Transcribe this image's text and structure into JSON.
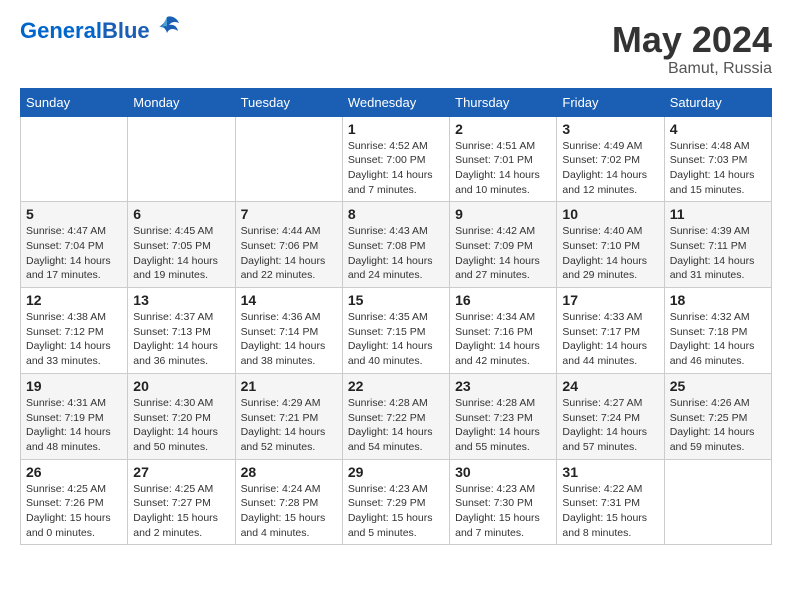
{
  "header": {
    "logo_general": "General",
    "logo_blue": "Blue",
    "month_title": "May 2024",
    "location": "Bamut, Russia"
  },
  "weekdays": [
    "Sunday",
    "Monday",
    "Tuesday",
    "Wednesday",
    "Thursday",
    "Friday",
    "Saturday"
  ],
  "weeks": [
    [
      {
        "day": "",
        "info": ""
      },
      {
        "day": "",
        "info": ""
      },
      {
        "day": "",
        "info": ""
      },
      {
        "day": "1",
        "info": "Sunrise: 4:52 AM\nSunset: 7:00 PM\nDaylight: 14 hours\nand 7 minutes."
      },
      {
        "day": "2",
        "info": "Sunrise: 4:51 AM\nSunset: 7:01 PM\nDaylight: 14 hours\nand 10 minutes."
      },
      {
        "day": "3",
        "info": "Sunrise: 4:49 AM\nSunset: 7:02 PM\nDaylight: 14 hours\nand 12 minutes."
      },
      {
        "day": "4",
        "info": "Sunrise: 4:48 AM\nSunset: 7:03 PM\nDaylight: 14 hours\nand 15 minutes."
      }
    ],
    [
      {
        "day": "5",
        "info": "Sunrise: 4:47 AM\nSunset: 7:04 PM\nDaylight: 14 hours\nand 17 minutes."
      },
      {
        "day": "6",
        "info": "Sunrise: 4:45 AM\nSunset: 7:05 PM\nDaylight: 14 hours\nand 19 minutes."
      },
      {
        "day": "7",
        "info": "Sunrise: 4:44 AM\nSunset: 7:06 PM\nDaylight: 14 hours\nand 22 minutes."
      },
      {
        "day": "8",
        "info": "Sunrise: 4:43 AM\nSunset: 7:08 PM\nDaylight: 14 hours\nand 24 minutes."
      },
      {
        "day": "9",
        "info": "Sunrise: 4:42 AM\nSunset: 7:09 PM\nDaylight: 14 hours\nand 27 minutes."
      },
      {
        "day": "10",
        "info": "Sunrise: 4:40 AM\nSunset: 7:10 PM\nDaylight: 14 hours\nand 29 minutes."
      },
      {
        "day": "11",
        "info": "Sunrise: 4:39 AM\nSunset: 7:11 PM\nDaylight: 14 hours\nand 31 minutes."
      }
    ],
    [
      {
        "day": "12",
        "info": "Sunrise: 4:38 AM\nSunset: 7:12 PM\nDaylight: 14 hours\nand 33 minutes."
      },
      {
        "day": "13",
        "info": "Sunrise: 4:37 AM\nSunset: 7:13 PM\nDaylight: 14 hours\nand 36 minutes."
      },
      {
        "day": "14",
        "info": "Sunrise: 4:36 AM\nSunset: 7:14 PM\nDaylight: 14 hours\nand 38 minutes."
      },
      {
        "day": "15",
        "info": "Sunrise: 4:35 AM\nSunset: 7:15 PM\nDaylight: 14 hours\nand 40 minutes."
      },
      {
        "day": "16",
        "info": "Sunrise: 4:34 AM\nSunset: 7:16 PM\nDaylight: 14 hours\nand 42 minutes."
      },
      {
        "day": "17",
        "info": "Sunrise: 4:33 AM\nSunset: 7:17 PM\nDaylight: 14 hours\nand 44 minutes."
      },
      {
        "day": "18",
        "info": "Sunrise: 4:32 AM\nSunset: 7:18 PM\nDaylight: 14 hours\nand 46 minutes."
      }
    ],
    [
      {
        "day": "19",
        "info": "Sunrise: 4:31 AM\nSunset: 7:19 PM\nDaylight: 14 hours\nand 48 minutes."
      },
      {
        "day": "20",
        "info": "Sunrise: 4:30 AM\nSunset: 7:20 PM\nDaylight: 14 hours\nand 50 minutes."
      },
      {
        "day": "21",
        "info": "Sunrise: 4:29 AM\nSunset: 7:21 PM\nDaylight: 14 hours\nand 52 minutes."
      },
      {
        "day": "22",
        "info": "Sunrise: 4:28 AM\nSunset: 7:22 PM\nDaylight: 14 hours\nand 54 minutes."
      },
      {
        "day": "23",
        "info": "Sunrise: 4:28 AM\nSunset: 7:23 PM\nDaylight: 14 hours\nand 55 minutes."
      },
      {
        "day": "24",
        "info": "Sunrise: 4:27 AM\nSunset: 7:24 PM\nDaylight: 14 hours\nand 57 minutes."
      },
      {
        "day": "25",
        "info": "Sunrise: 4:26 AM\nSunset: 7:25 PM\nDaylight: 14 hours\nand 59 minutes."
      }
    ],
    [
      {
        "day": "26",
        "info": "Sunrise: 4:25 AM\nSunset: 7:26 PM\nDaylight: 15 hours\nand 0 minutes."
      },
      {
        "day": "27",
        "info": "Sunrise: 4:25 AM\nSunset: 7:27 PM\nDaylight: 15 hours\nand 2 minutes."
      },
      {
        "day": "28",
        "info": "Sunrise: 4:24 AM\nSunset: 7:28 PM\nDaylight: 15 hours\nand 4 minutes."
      },
      {
        "day": "29",
        "info": "Sunrise: 4:23 AM\nSunset: 7:29 PM\nDaylight: 15 hours\nand 5 minutes."
      },
      {
        "day": "30",
        "info": "Sunrise: 4:23 AM\nSunset: 7:30 PM\nDaylight: 15 hours\nand 7 minutes."
      },
      {
        "day": "31",
        "info": "Sunrise: 4:22 AM\nSunset: 7:31 PM\nDaylight: 15 hours\nand 8 minutes."
      },
      {
        "day": "",
        "info": ""
      }
    ]
  ]
}
